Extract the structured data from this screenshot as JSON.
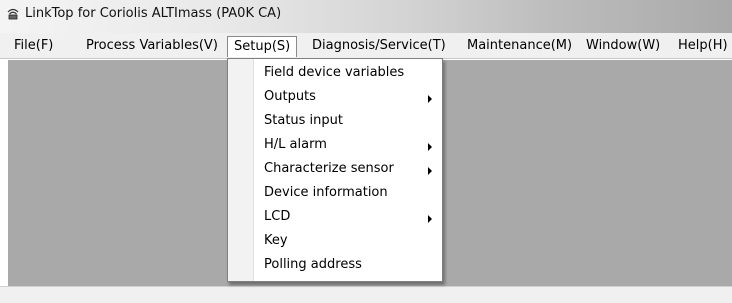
{
  "window": {
    "title": "LinkTop for Coriolis ALTImass (PA0K CA)",
    "icon": "radar-icon"
  },
  "menubar": {
    "items": [
      {
        "label": "File(F)"
      },
      {
        "label": "Process Variables(V)"
      },
      {
        "label": "Setup(S)",
        "active": true
      },
      {
        "label": "Diagnosis/Service(T)"
      },
      {
        "label": "Maintenance(M)"
      },
      {
        "label": "Window(W)"
      },
      {
        "label": "Help(H)"
      }
    ]
  },
  "setup_menu": {
    "items": [
      {
        "label": "Field device variables",
        "submenu": false
      },
      {
        "label": "Outputs",
        "submenu": true
      },
      {
        "label": "Status input",
        "submenu": false
      },
      {
        "label": "H/L alarm",
        "submenu": true
      },
      {
        "label": "Characterize sensor",
        "submenu": true
      },
      {
        "label": "Device information",
        "submenu": false
      },
      {
        "label": "LCD",
        "submenu": true
      },
      {
        "label": "Key",
        "submenu": false
      },
      {
        "label": "Polling address",
        "submenu": false
      }
    ]
  },
  "colors": {
    "client_background": "#a9a9a9",
    "menu_background": "#f0f0f0"
  }
}
